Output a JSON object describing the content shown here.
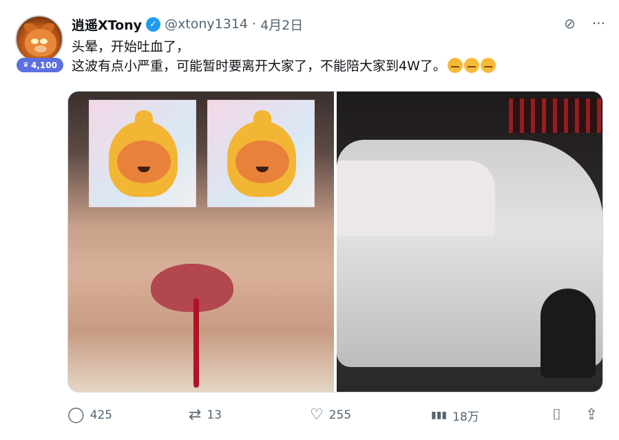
{
  "author": {
    "name": "逍遥XTony",
    "handle": "@xtony1314",
    "separator": "·",
    "date": "4月2日",
    "badge_count": "4,100",
    "verified_icon": "✓"
  },
  "tweet": {
    "line1": "头晕，开始吐血了，",
    "line2": "这波有点小严重，可能暂时要离开大家了，不能陪大家到4W了。"
  },
  "icons": {
    "grok": "⊘",
    "more": "···",
    "reply": "◯",
    "retweet": "⇄",
    "like": "♡",
    "views": "▮▮▮",
    "bookmark": "⌷",
    "share": "⇪",
    "trophy": "♛"
  },
  "metrics": {
    "replies": "425",
    "retweets": "13",
    "likes": "255",
    "views": "18万"
  }
}
